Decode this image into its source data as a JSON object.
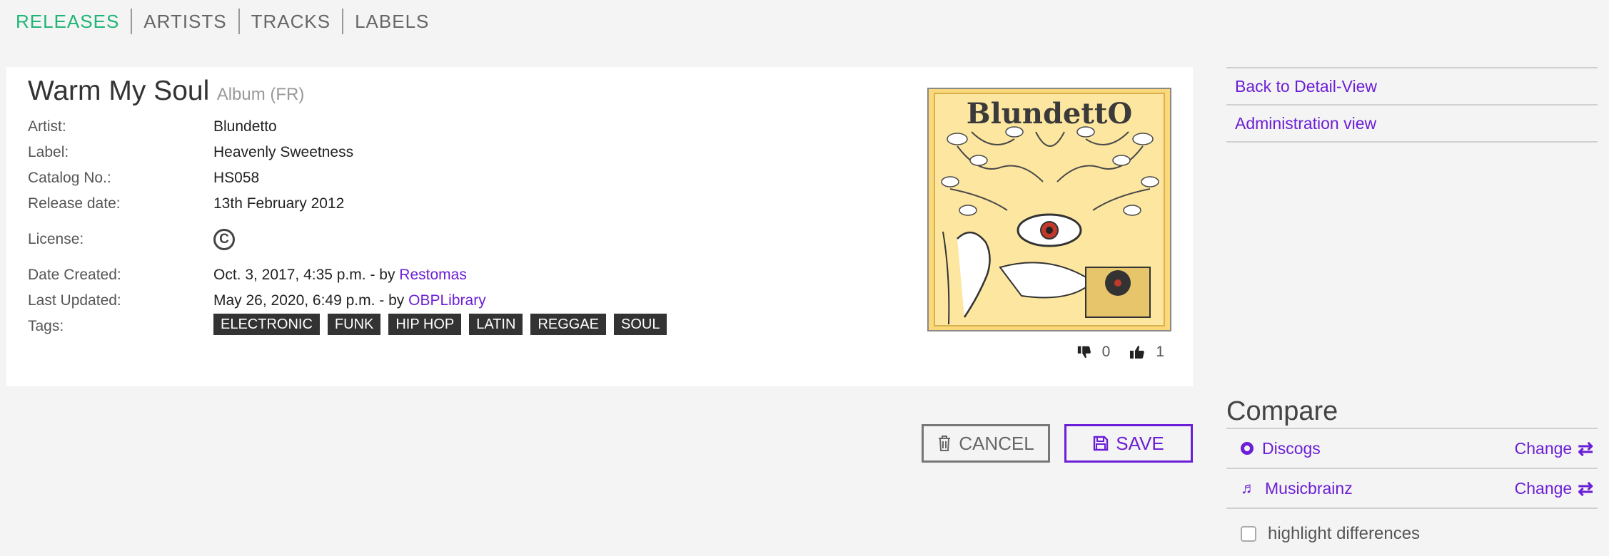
{
  "nav": [
    "RELEASES",
    "ARTISTS",
    "TRACKS",
    "LABELS"
  ],
  "release": {
    "title": "Warm My Soul",
    "subtitle": "Album (FR)",
    "fields": {
      "artist_label": "Artist:",
      "artist": "Blundetto",
      "label_label": "Label:",
      "label": "Heavenly Sweetness",
      "catalog_label": "Catalog No.:",
      "catalog": "HS058",
      "release_date_label": "Release date:",
      "release_date": "13th February 2012",
      "license_label": "License:",
      "license_symbol": "C",
      "created_label": "Date Created:",
      "created": "Oct. 3, 2017, 4:35 p.m. - by ",
      "created_by": "Restomas",
      "updated_label": "Last Updated:",
      "updated": "May 26, 2020, 6:49 p.m. - by ",
      "updated_by": "OBPLibrary",
      "tags_label": "Tags:"
    },
    "tags": [
      "ELECTRONIC",
      "FUNK",
      "HIP HOP",
      "LATIN",
      "REGGAE",
      "SOUL"
    ],
    "cover_text": "BlundettO",
    "votes": {
      "down": "0",
      "up": "1"
    }
  },
  "buttons": {
    "cancel": "CANCEL",
    "save": "SAVE"
  },
  "sidebar": {
    "links": [
      "Back to Detail-View",
      "Administration view"
    ],
    "compare_title": "Compare",
    "compare": [
      {
        "name": "Discogs",
        "action": "Change"
      },
      {
        "name": "Musicbrainz",
        "action": "Change"
      }
    ],
    "highlight_label": "highlight differences"
  },
  "colors": {
    "accent": "#6b1fd6",
    "active_nav": "#1fb577",
    "tag_bg": "#333333",
    "cover_bg": "#fbd97a"
  }
}
